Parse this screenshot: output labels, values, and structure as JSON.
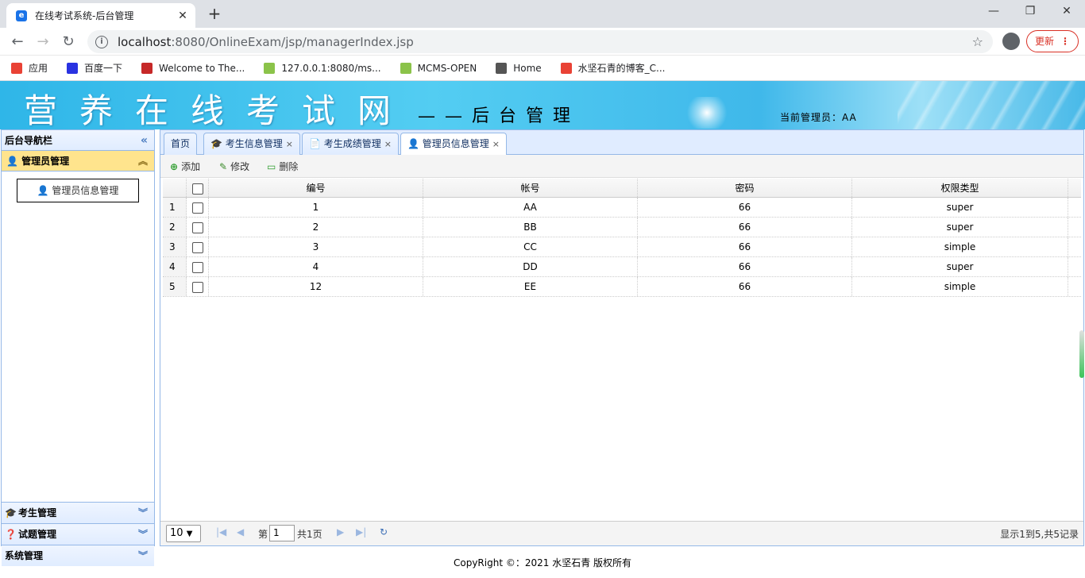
{
  "browser": {
    "tab_title": "在线考试系统-后台管理",
    "url_host": "localhost",
    "url_path": ":8080/OnlineExam/jsp/managerIndex.jsp",
    "update_label": "更新",
    "bookmarks": [
      {
        "label": "应用",
        "color": "#e94235"
      },
      {
        "label": "百度一下",
        "color": "#2932e1"
      },
      {
        "label": "Welcome to The...",
        "color": "#c62828"
      },
      {
        "label": "127.0.0.1:8080/ms...",
        "color": "#8bc34a"
      },
      {
        "label": "MCMS-OPEN",
        "color": "#8bc34a"
      },
      {
        "label": "Home",
        "color": "#555555"
      },
      {
        "label": "水坚石青的博客_C...",
        "color": "#e94235"
      }
    ]
  },
  "banner": {
    "title": "营养在线考试网",
    "subtitle": "——后台管理",
    "current_admin": "当前管理员：AA"
  },
  "sidebar": {
    "title": "后台导航栏",
    "active_group": "管理员管理",
    "active_item": "管理员信息管理",
    "groups": [
      {
        "label": "考生管理"
      },
      {
        "label": "试题管理"
      },
      {
        "label": "系统管理"
      }
    ]
  },
  "tabs": [
    {
      "label": "首页"
    },
    {
      "label": "考生信息管理"
    },
    {
      "label": "考生成绩管理"
    },
    {
      "label": "管理员信息管理"
    }
  ],
  "toolbar": {
    "add": "添加",
    "edit": "修改",
    "delete": "删除"
  },
  "table": {
    "columns": [
      "编号",
      "帐号",
      "密码",
      "权限类型"
    ],
    "rows": [
      {
        "n": "1",
        "id": "1",
        "account": "AA",
        "password": "66",
        "role": "super"
      },
      {
        "n": "2",
        "id": "2",
        "account": "BB",
        "password": "66",
        "role": "super"
      },
      {
        "n": "3",
        "id": "3",
        "account": "CC",
        "password": "66",
        "role": "simple"
      },
      {
        "n": "4",
        "id": "4",
        "account": "DD",
        "password": "66",
        "role": "super"
      },
      {
        "n": "5",
        "id": "12",
        "account": "EE",
        "password": "66",
        "role": "simple"
      }
    ]
  },
  "pager": {
    "page_size": "10",
    "page_prefix": "第",
    "page_value": "1",
    "page_total": "共1页",
    "summary": "显示1到5,共5记录"
  },
  "footer": {
    "copyright": "CopyRight ©：2021 水坚石青 版权所有"
  }
}
